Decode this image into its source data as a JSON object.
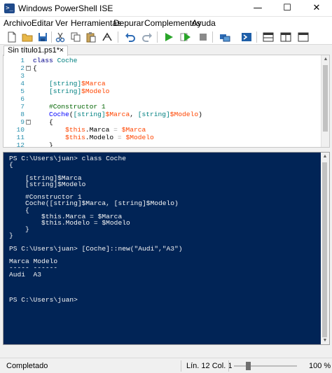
{
  "window": {
    "title": "Windows PowerShell ISE",
    "app_icon": "powershell-ise-icon",
    "minimize": "—",
    "maximize": "☐",
    "close": "✕"
  },
  "menu": [
    {
      "label": "Archivo"
    },
    {
      "label": "Editar"
    },
    {
      "label": "Ver"
    },
    {
      "label": "Herramientas"
    },
    {
      "label": "Depurar"
    },
    {
      "label": "Complementos"
    },
    {
      "label": "Ayuda"
    }
  ],
  "toolbar": {
    "icons": [
      "new-file-icon",
      "open-folder-icon",
      "save-icon",
      "cut-icon",
      "copy-icon",
      "paste-icon",
      "clear-console-icon",
      "undo-icon",
      "redo-icon",
      "run-icon",
      "run-selection-icon",
      "stop-icon",
      "new-remote-tab-icon",
      "powershell-console-icon",
      "script-pane-top-icon",
      "script-pane-right-icon",
      "script-pane-maximized-icon"
    ]
  },
  "tab": {
    "label": "Sin título1.ps1*",
    "close": "×"
  },
  "editor": {
    "line_numbers": [
      "1",
      "2",
      "3",
      "4",
      "5",
      "6",
      "7",
      "8",
      "9",
      "10",
      "11",
      "12"
    ]
  },
  "console": {
    "lines": [
      "PS C:\\Users\\juan> class Coche",
      "{",
      "",
      "    [string]$Marca",
      "    [string]$Modelo",
      "",
      "    #Constructor 1",
      "    Coche([string]$Marca, [string]$Modelo)",
      "    {",
      "        $this.Marca = $Marca",
      "        $this.Modelo = $Modelo",
      "    }",
      "}",
      "",
      "PS C:\\Users\\juan> [Coche]::new(\"Audi\",\"A3\")",
      "",
      "Marca Modelo",
      "----- ------",
      "Audi  A3",
      "",
      "",
      "",
      "PS C:\\Users\\juan>"
    ]
  },
  "status": {
    "text": "Completado",
    "position": "Lín. 12  Col. 1",
    "zoom": "100 %",
    "zoom_level_percent": 100
  },
  "colors": {
    "console_bg": "#012456",
    "keyword": "#00008b",
    "type": "#008080",
    "variable": "#ff4500",
    "comment": "#006400",
    "line_number": "#2b91af"
  }
}
